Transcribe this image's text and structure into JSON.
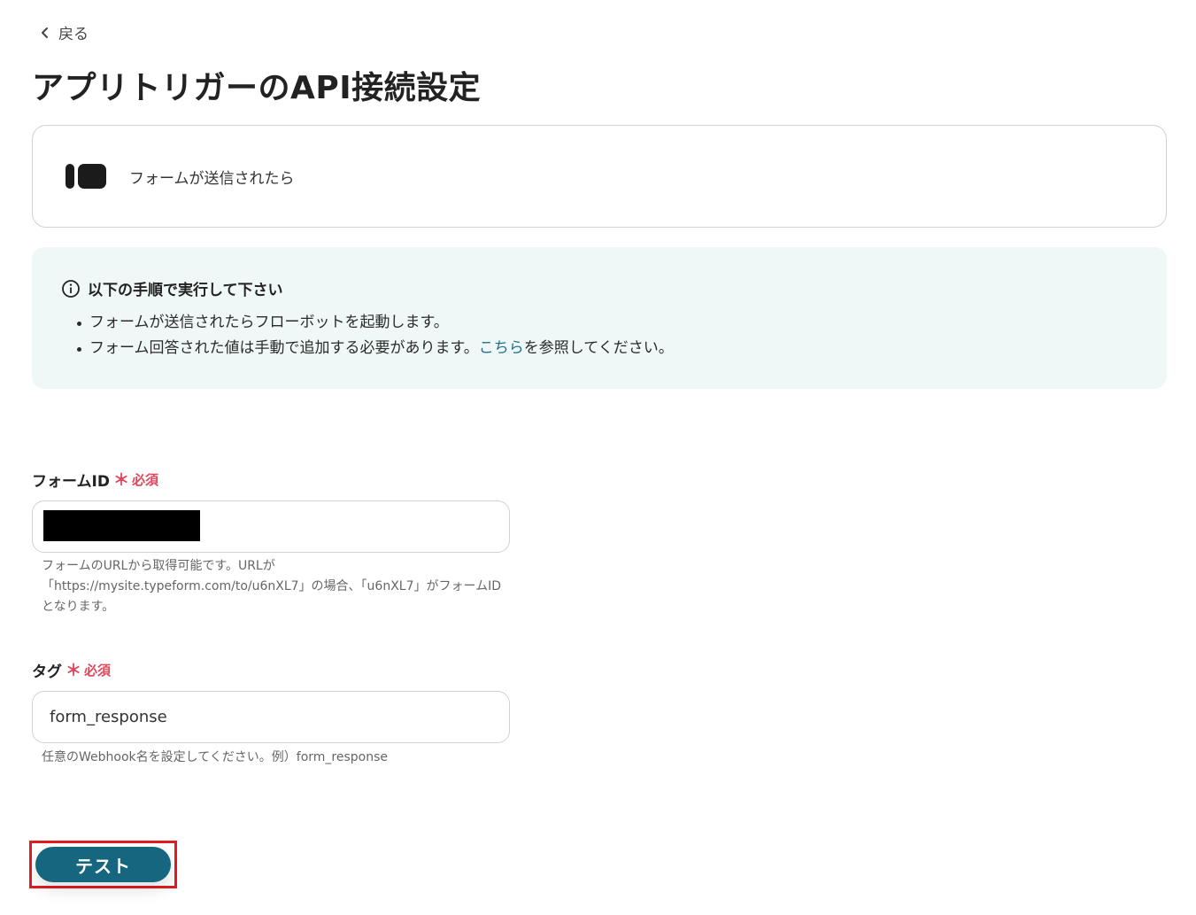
{
  "nav": {
    "back_label": "戻る",
    "back_icon": "chevron-left-icon"
  },
  "page": {
    "title": "アプリトリガーのAPI接続設定"
  },
  "app_card": {
    "logo_icon": "typeform-logo",
    "trigger_label": "フォームが送信されたら"
  },
  "info": {
    "heading": "以下の手順で実行して下さい",
    "items": [
      "フォームが送信されたらフローボットを起動します。",
      "フォーム回答された値は手動で追加する必要があります。"
    ],
    "link_text": "こちら",
    "link_suffix": "を参照してください。"
  },
  "fields": {
    "form_id": {
      "label": "フォームID",
      "required": "必須",
      "value": "",
      "help": "フォームのURLから取得可能です。URLが「https://mysite.typeform.com/to/u6nXL7」の場合、「u6nXL7」がフォームIDとなります。"
    },
    "tag": {
      "label": "タグ",
      "required": "必須",
      "value": "form_response",
      "help": "任意のWebhook名を設定してください。例）form_response"
    }
  },
  "actions": {
    "test_label": "テスト"
  },
  "colors": {
    "accent": "#16667f",
    "required": "#e0475b",
    "info_bg": "#eff8f6",
    "link": "#1f6f8b",
    "highlight_border": "#e11b22"
  }
}
